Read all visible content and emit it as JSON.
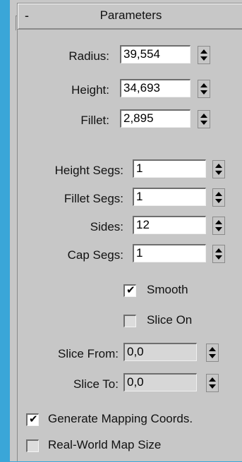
{
  "rollout": {
    "collapse_symbol": "-",
    "title": "Parameters"
  },
  "fields": {
    "radius": {
      "label": "Radius:",
      "value": "39,554"
    },
    "height": {
      "label": "Height:",
      "value": "34,693"
    },
    "fillet": {
      "label": "Fillet:",
      "value": "2,895"
    },
    "height_segs": {
      "label": "Height Segs:",
      "value": "1"
    },
    "fillet_segs": {
      "label": "Fillet Segs:",
      "value": "1"
    },
    "sides": {
      "label": "Sides:",
      "value": "12"
    },
    "cap_segs": {
      "label": "Cap Segs:",
      "value": "1"
    },
    "slice_from": {
      "label": "Slice From:",
      "value": "0,0"
    },
    "slice_to": {
      "label": "Slice To:",
      "value": "0,0"
    }
  },
  "checkboxes": {
    "smooth": {
      "label": "Smooth",
      "checked": true,
      "mark": "✔"
    },
    "slice_on": {
      "label": "Slice On",
      "checked": false
    },
    "generate_mapping": {
      "label": "Generate Mapping Coords.",
      "checked": true,
      "mark": "✔"
    },
    "real_world_map": {
      "label": "Real-World Map Size",
      "checked": false
    }
  }
}
